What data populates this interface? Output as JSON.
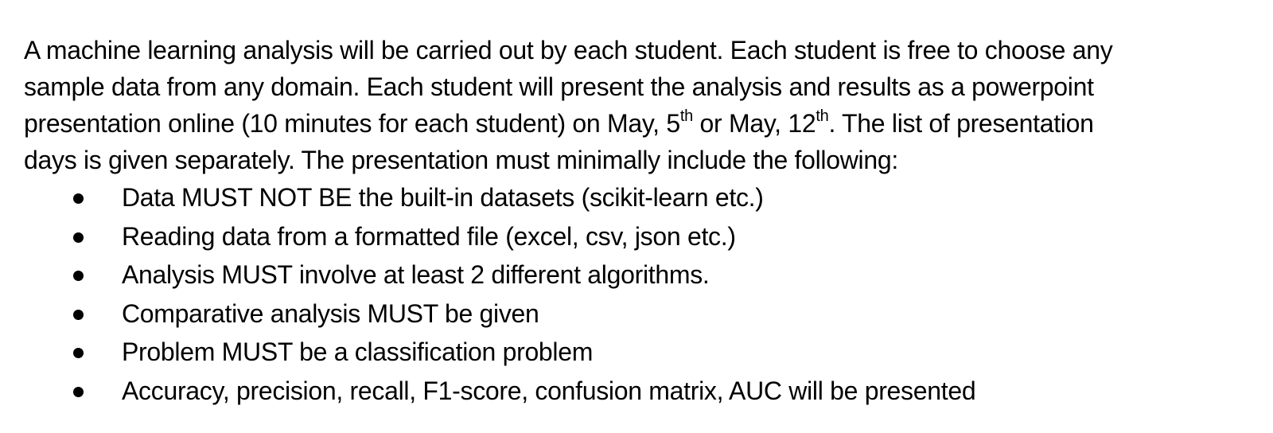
{
  "paragraph": {
    "line1": "A machine learning analysis will be carried out by each student. Each student is free to choose any",
    "line2": "sample data from any domain. Each student will present the analysis and results as a powerpoint",
    "line3_a": "presentation online (10 minutes for each student) on May, 5",
    "line3_sup1": "th",
    "line3_b": " or May, 12",
    "line3_sup2": "th",
    "line3_c": ". The list of presentation",
    "line4": "days is given separately. The presentation must minimally include the following:"
  },
  "requirements": [
    "Data MUST NOT BE the built-in datasets (scikit-learn etc.)",
    "Reading data from a formatted file (excel, csv, json etc.)",
    "Analysis MUST involve at least 2 different algorithms.",
    "Comparative analysis MUST be given",
    "Problem MUST be a classification problem",
    "Accuracy, precision, recall, F1-score, confusion matrix, AUC will be presented"
  ]
}
